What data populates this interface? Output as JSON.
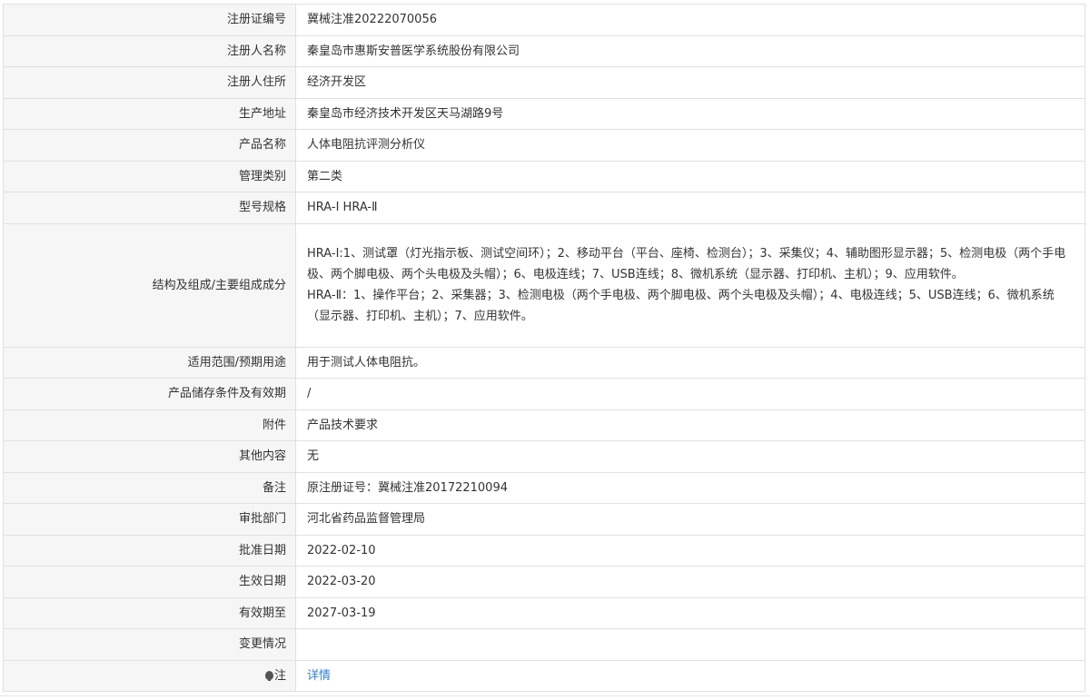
{
  "rows": [
    {
      "label": "注册证编号",
      "value": "冀械注准20222070056"
    },
    {
      "label": "注册人名称",
      "value": "秦皇岛市惠斯安普医学系统股份有限公司"
    },
    {
      "label": "注册人住所",
      "value": "经济开发区"
    },
    {
      "label": "生产地址",
      "value": "秦皇岛市经济技术开发区天马湖路9号"
    },
    {
      "label": "产品名称",
      "value": "人体电阻抗评测分析仪"
    },
    {
      "label": "管理类别",
      "value": "第二类"
    },
    {
      "label": "型号规格",
      "value": "HRA-I HRA-Ⅱ"
    },
    {
      "label": "结构及组成/主要组成成分",
      "value_line1": "HRA-I:1、测试罩（灯光指示板、测试空间环）；2、移动平台（平台、座椅、检测台）；3、采集仪；4、辅助图形显示器；5、检测电极（两个手电极、两个脚电极、两个头电极及头帽）；6、电极连线；7、USB连线；8、微机系统（显示器、打印机、主机）；9、应用软件。",
      "value_line2": "HRA-Ⅱ：1、操作平台；2、采集器；3、检测电极（两个手电极、两个脚电极、两个头电极及头帽）；4、电极连线；5、USB连线；6、微机系统（显示器、打印机、主机）；7、应用软件。"
    },
    {
      "label": "适用范围/预期用途",
      "value": "用于测试人体电阻抗。"
    },
    {
      "label": "产品储存条件及有效期",
      "value": "/"
    },
    {
      "label": "附件",
      "value": "产品技术要求"
    },
    {
      "label": "其他内容",
      "value": "无"
    },
    {
      "label": "备注",
      "value": "原注册证号：冀械注准20172210094"
    },
    {
      "label": "审批部门",
      "value": "河北省药品监督管理局"
    },
    {
      "label": "批准日期",
      "value": "2022-02-10"
    },
    {
      "label": "生效日期",
      "value": "2022-03-20"
    },
    {
      "label": "有效期至",
      "value": "2027-03-19"
    },
    {
      "label": "变更情况",
      "value": ""
    },
    {
      "label": "注",
      "value": "详情",
      "icon": "bulb-icon"
    }
  ]
}
